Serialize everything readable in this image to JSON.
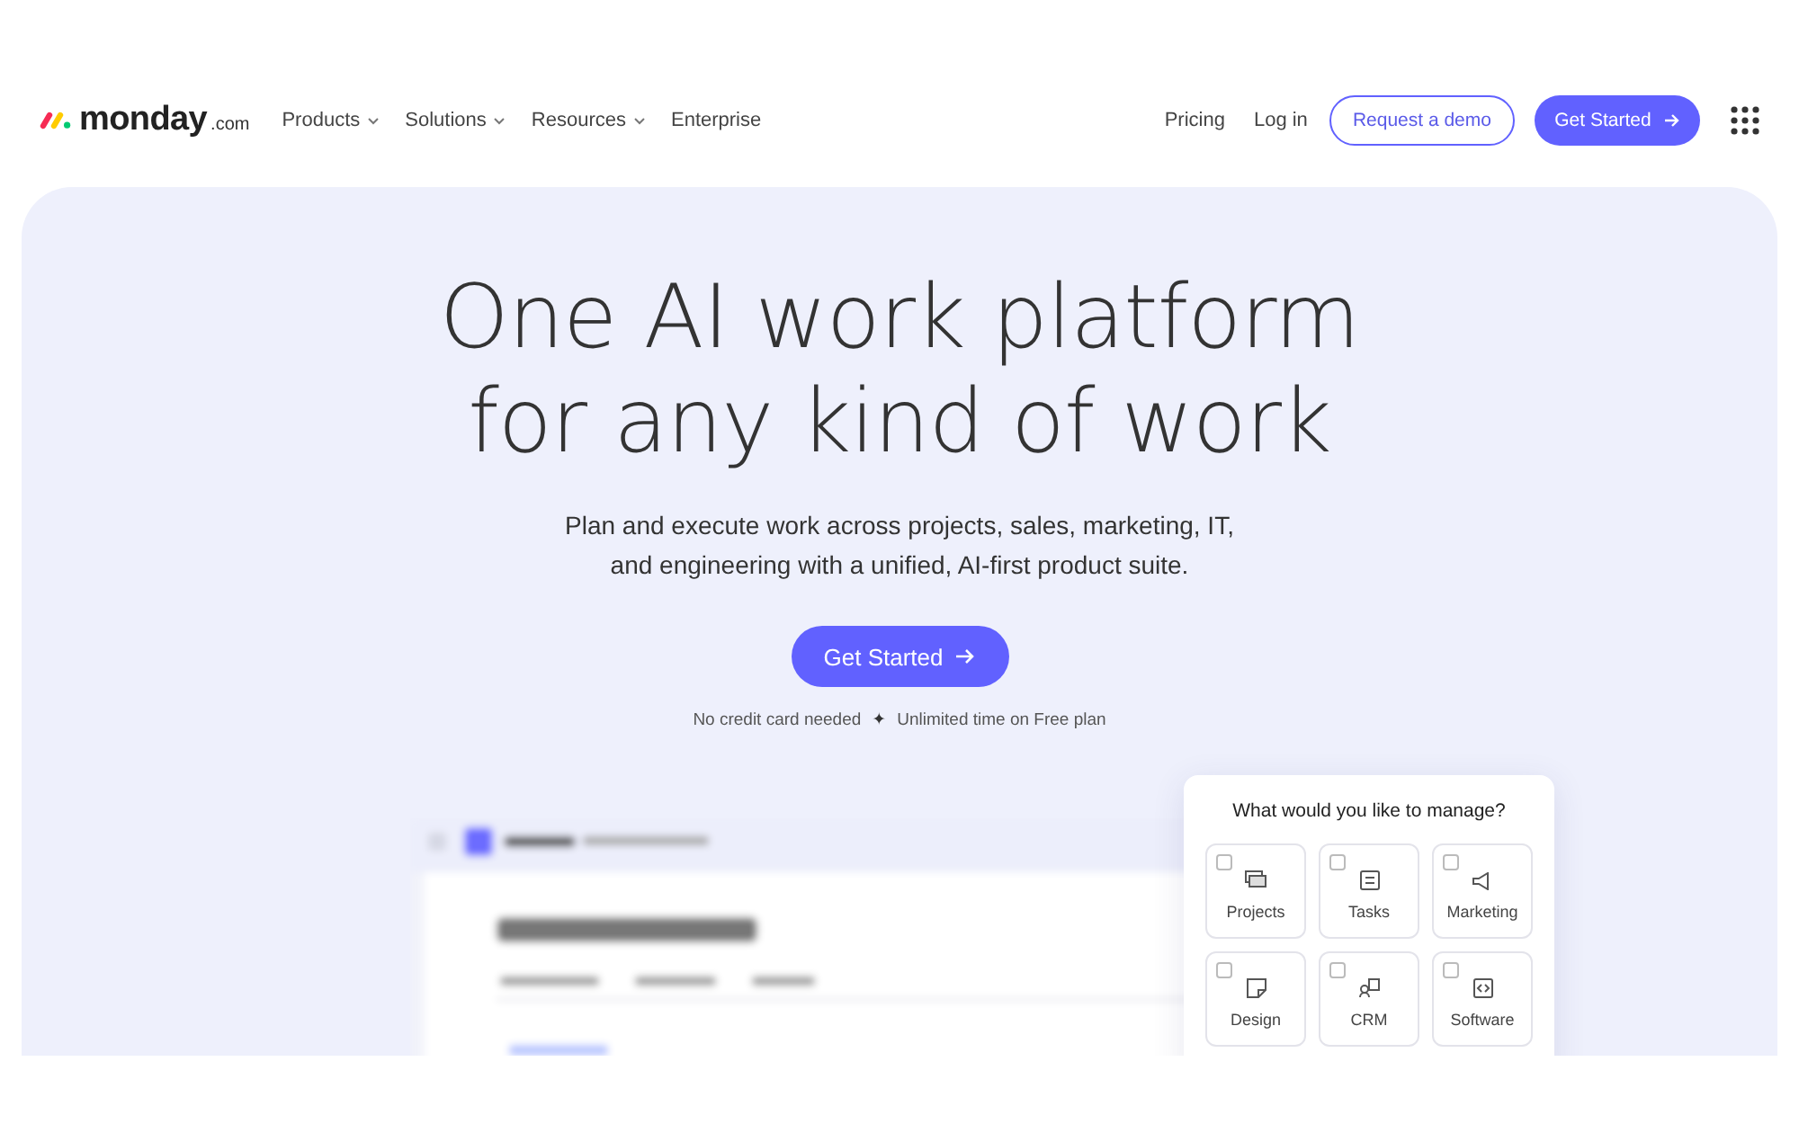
{
  "nav": {
    "logo": {
      "name": "monday",
      "suffix": ".com"
    },
    "menu": [
      {
        "label": "Products",
        "dropdown": true
      },
      {
        "label": "Solutions",
        "dropdown": true
      },
      {
        "label": "Resources",
        "dropdown": true
      },
      {
        "label": "Enterprise",
        "dropdown": false
      }
    ],
    "links": [
      "Pricing",
      "Log in"
    ],
    "demo_button": "Request a demo",
    "cta_button": "Get Started"
  },
  "hero": {
    "title_lines": [
      "One AI work platform",
      "for any kind of work"
    ],
    "subtitle_lines": [
      "Plan and execute work across projects, sales, marketing, IT,",
      "and engineering with a unified, AI-first product suite."
    ],
    "cta_button": "Get Started",
    "note": [
      "No credit card needed",
      "✦",
      "Unlimited time on Free plan"
    ],
    "preview": {
      "kind": "picture"
    }
  },
  "manage_panel": {
    "title": "What would you like to manage?",
    "options": [
      {
        "label": "Projects",
        "kind": "projects",
        "checked": false
      },
      {
        "label": "Tasks",
        "kind": "tasks",
        "checked": false
      },
      {
        "label": "Marketing",
        "kind": "marketing",
        "checked": false
      },
      {
        "label": "Design",
        "kind": "design",
        "checked": false
      },
      {
        "label": "CRM",
        "kind": "crm",
        "checked": false
      },
      {
        "label": "Software",
        "kind": "software",
        "checked": false
      }
    ]
  }
}
